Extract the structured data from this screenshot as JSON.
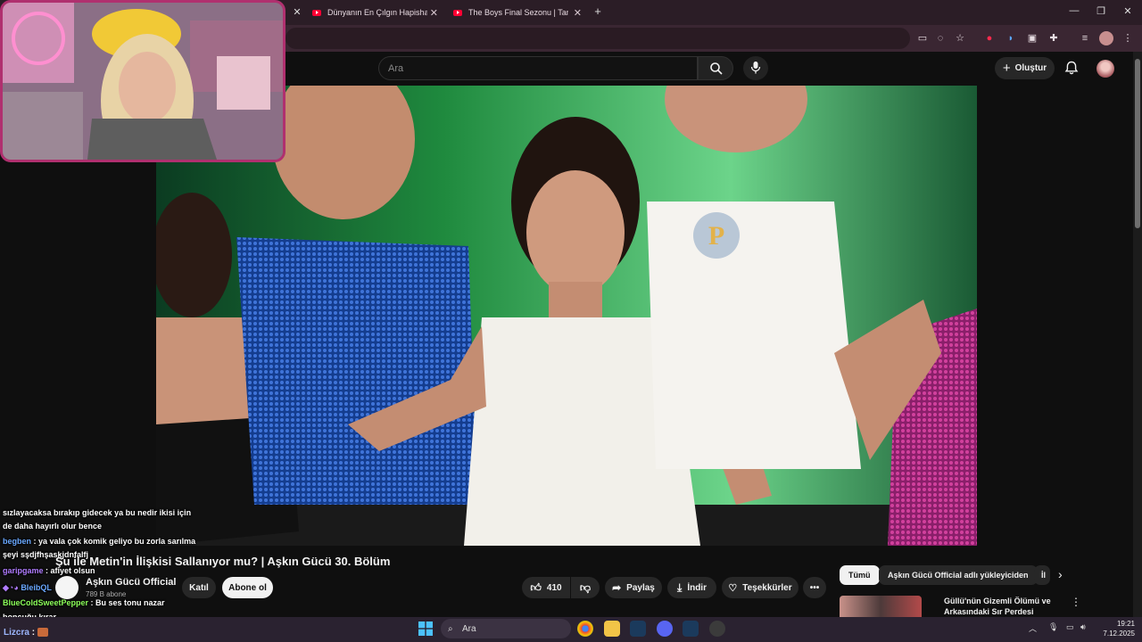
{
  "browser": {
    "tabs": [
      {
        "title": "Dünyanın En Çılgın Hapishane"
      },
      {
        "title": "The Boys Final Sezonu | Tanıtım"
      }
    ],
    "new_tab_glyph": "+",
    "close_glyph": "✕",
    "window_controls": {
      "minimize": "—",
      "restore": "❐",
      "close": "✕"
    }
  },
  "youtube": {
    "search_placeholder": "Ara",
    "create_label": "Oluştur",
    "video": {
      "title": "Şu ile Metin'in İlişkisi Sallanıyor mu? | Aşkın Gücü 30. Bölüm",
      "channel": "Aşkın Gücü Official",
      "subscribers": "789 B abone",
      "join_label": "Katıl",
      "subscribe_label": "Abone ol",
      "like_count": "410",
      "share_label": "Paylaş",
      "download_label": "İndir",
      "thanks_label": "Teşekkürler"
    },
    "chips": [
      {
        "label": "Tümü",
        "active": true
      },
      {
        "label": "Aşkın Gücü Official adlı yükleyiciden",
        "active": false
      },
      {
        "label": "İl",
        "active": false
      }
    ],
    "recommendation": {
      "title": "Güllü'nün Gizemli Ölümü ve Arkasındaki Sır Perdesi"
    }
  },
  "chat": [
    {
      "user": "",
      "user_color": "#ffffff",
      "text": "sızlayacaksa bırakıp gidecek ya bu nedir ikisi için"
    },
    {
      "user": "",
      "user_color": "#ffffff",
      "text": "de daha hayırlı olur bence"
    },
    {
      "user": "begben",
      "user_color": "#6aa8ff",
      "text": ": ya vala çok komik geliyo bu zorla sarılma"
    },
    {
      "user": "",
      "user_color": "#ffffff",
      "text": "şeyi sşdjfhşaskjdnfalfj"
    },
    {
      "user": "garipgame",
      "user_color": "#b07cff",
      "text": ": afiyet olsun"
    },
    {
      "user": "BleibQL",
      "user_color": "#6aa8ff",
      "text": ""
    },
    {
      "user": "BlueColdSweetPepper",
      "user_color": "#8cff5a",
      "text": ": Bu ses tonu nazar"
    },
    {
      "user": "",
      "user_color": "#ffffff",
      "text": "boncuğu kırar"
    }
  ],
  "overlay_footer": {
    "user": "Lizcra",
    "text": ":"
  },
  "taskbar": {
    "search_label": "Ara",
    "time": "19:21",
    "date": "7.12.2025"
  },
  "colors": {
    "webcam_border": "#b0306f",
    "youtube_red": "#ff0033",
    "chrome_frame": "#2b1d26"
  }
}
